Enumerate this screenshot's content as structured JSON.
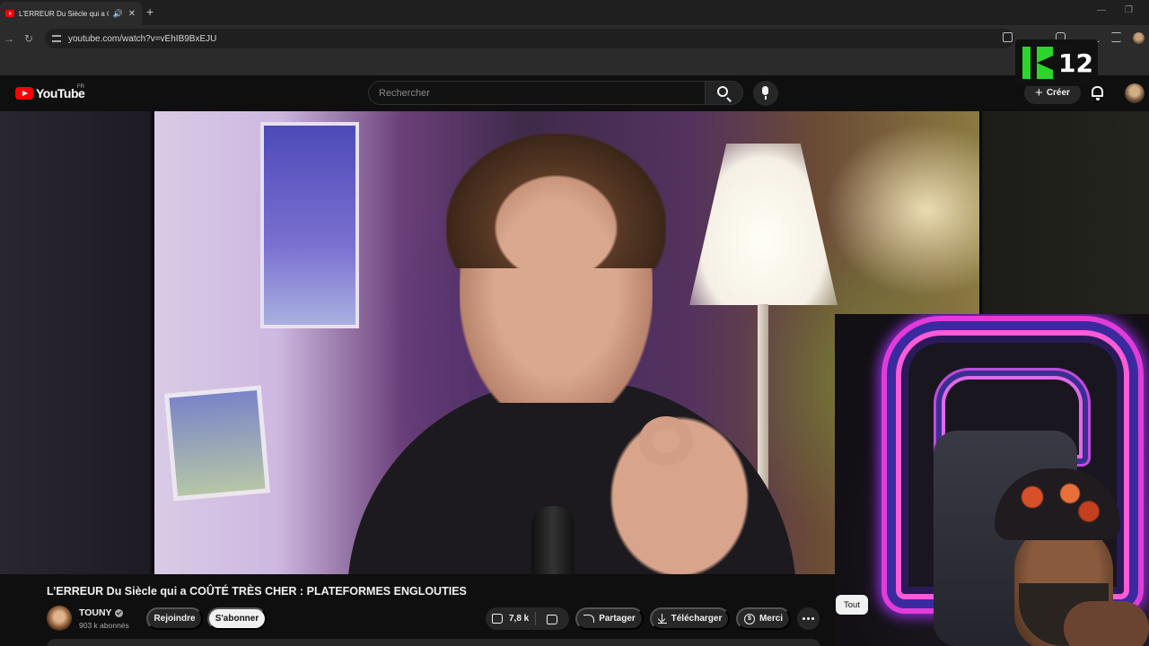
{
  "browser": {
    "tab_title": "L'ERREUR Du Siècle qui a COÛTÉ TRÈS CHER : PLATEFORMES ENGLOUTIES",
    "tab_audio_icon": "speaker-icon",
    "tab_close": "✕",
    "new_tab": "+",
    "url": "youtube.com/watch?v=vEhIB9BxEJU",
    "minimize": "—",
    "maximize": "❐"
  },
  "overlay": {
    "badge_number": "12"
  },
  "youtube": {
    "logo_text": "YouTube",
    "country_code": "FR",
    "search_placeholder": "Rechercher",
    "create_label": "Créer"
  },
  "video": {
    "title": "L’ERREUR Du Siècle qui a COÛTÉ TRÈS CHER : PLATEFORMES ENGLOUTIES",
    "channel_name": "TOUNY",
    "subscribers": "903 k abonnés",
    "join_label": "Rejoindre",
    "subscribe_label": "S'abonner",
    "like_count": "7,8 k",
    "share_label": "Partager",
    "download_label": "Télécharger",
    "thanks_label": "Merci"
  },
  "chips": {
    "all_label": "Tout"
  },
  "colors": {
    "background": "#0f0f0f",
    "brand_red": "#ff0000",
    "badge_green": "#2bd52b",
    "pill_dark": "#272727",
    "pill_light": "#f1f1f1"
  }
}
